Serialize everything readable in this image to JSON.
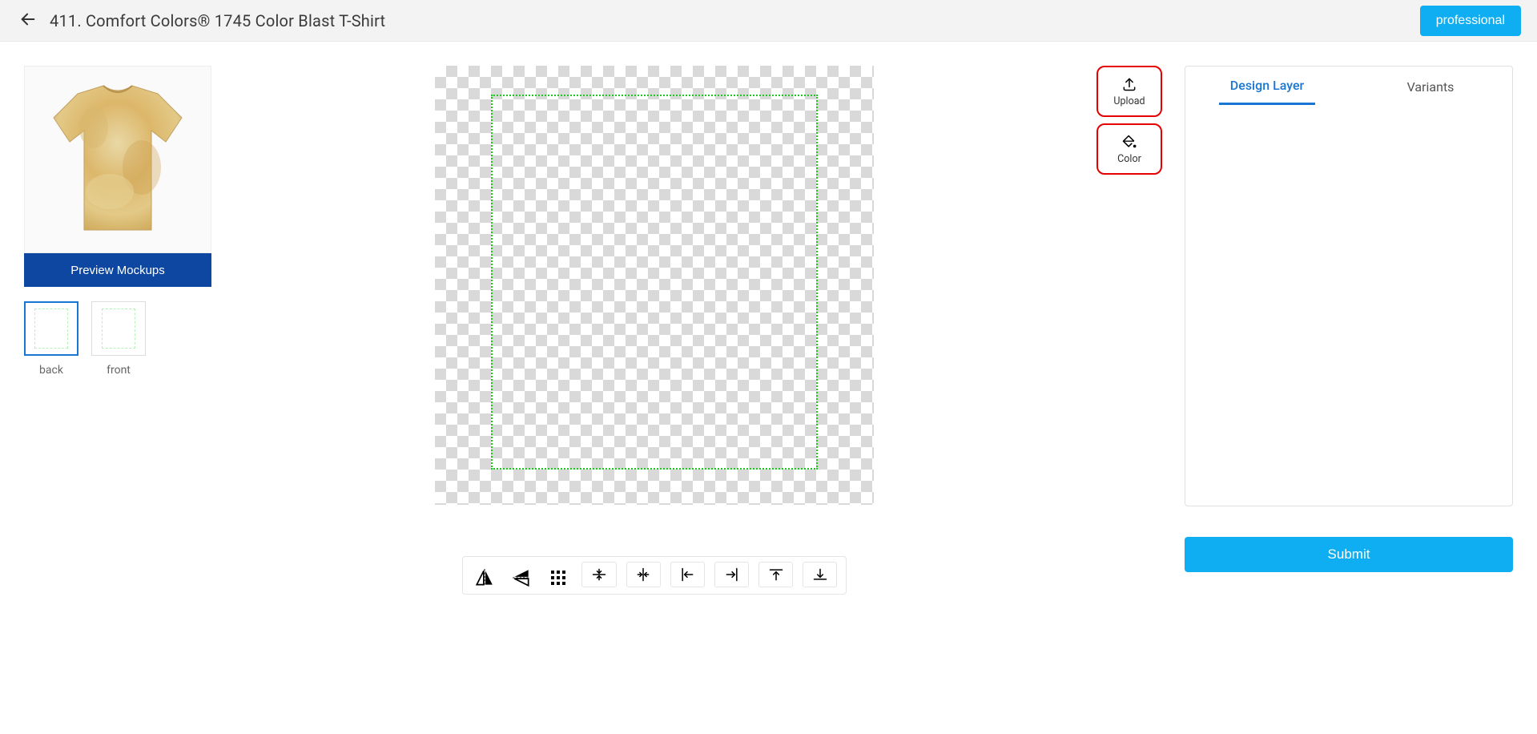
{
  "header": {
    "title": "411. Comfort Colors® 1745 Color Blast T-Shirt",
    "pro_button": "professional"
  },
  "left": {
    "preview_button": "Preview Mockups",
    "thumbs": [
      {
        "label": "back",
        "active": true
      },
      {
        "label": "front",
        "active": false
      }
    ]
  },
  "tools_right": {
    "upload": "Upload",
    "color": "Color"
  },
  "panel": {
    "tabs": [
      {
        "label": "Design Layer",
        "active": true
      },
      {
        "label": "Variants",
        "active": false
      }
    ]
  },
  "submit": "Submit",
  "toolbar": {
    "items": [
      "flip-horizontal",
      "flip-vertical",
      "grid",
      "align-vcenter",
      "align-hcenter",
      "align-left",
      "align-right",
      "align-top",
      "align-bottom"
    ]
  }
}
